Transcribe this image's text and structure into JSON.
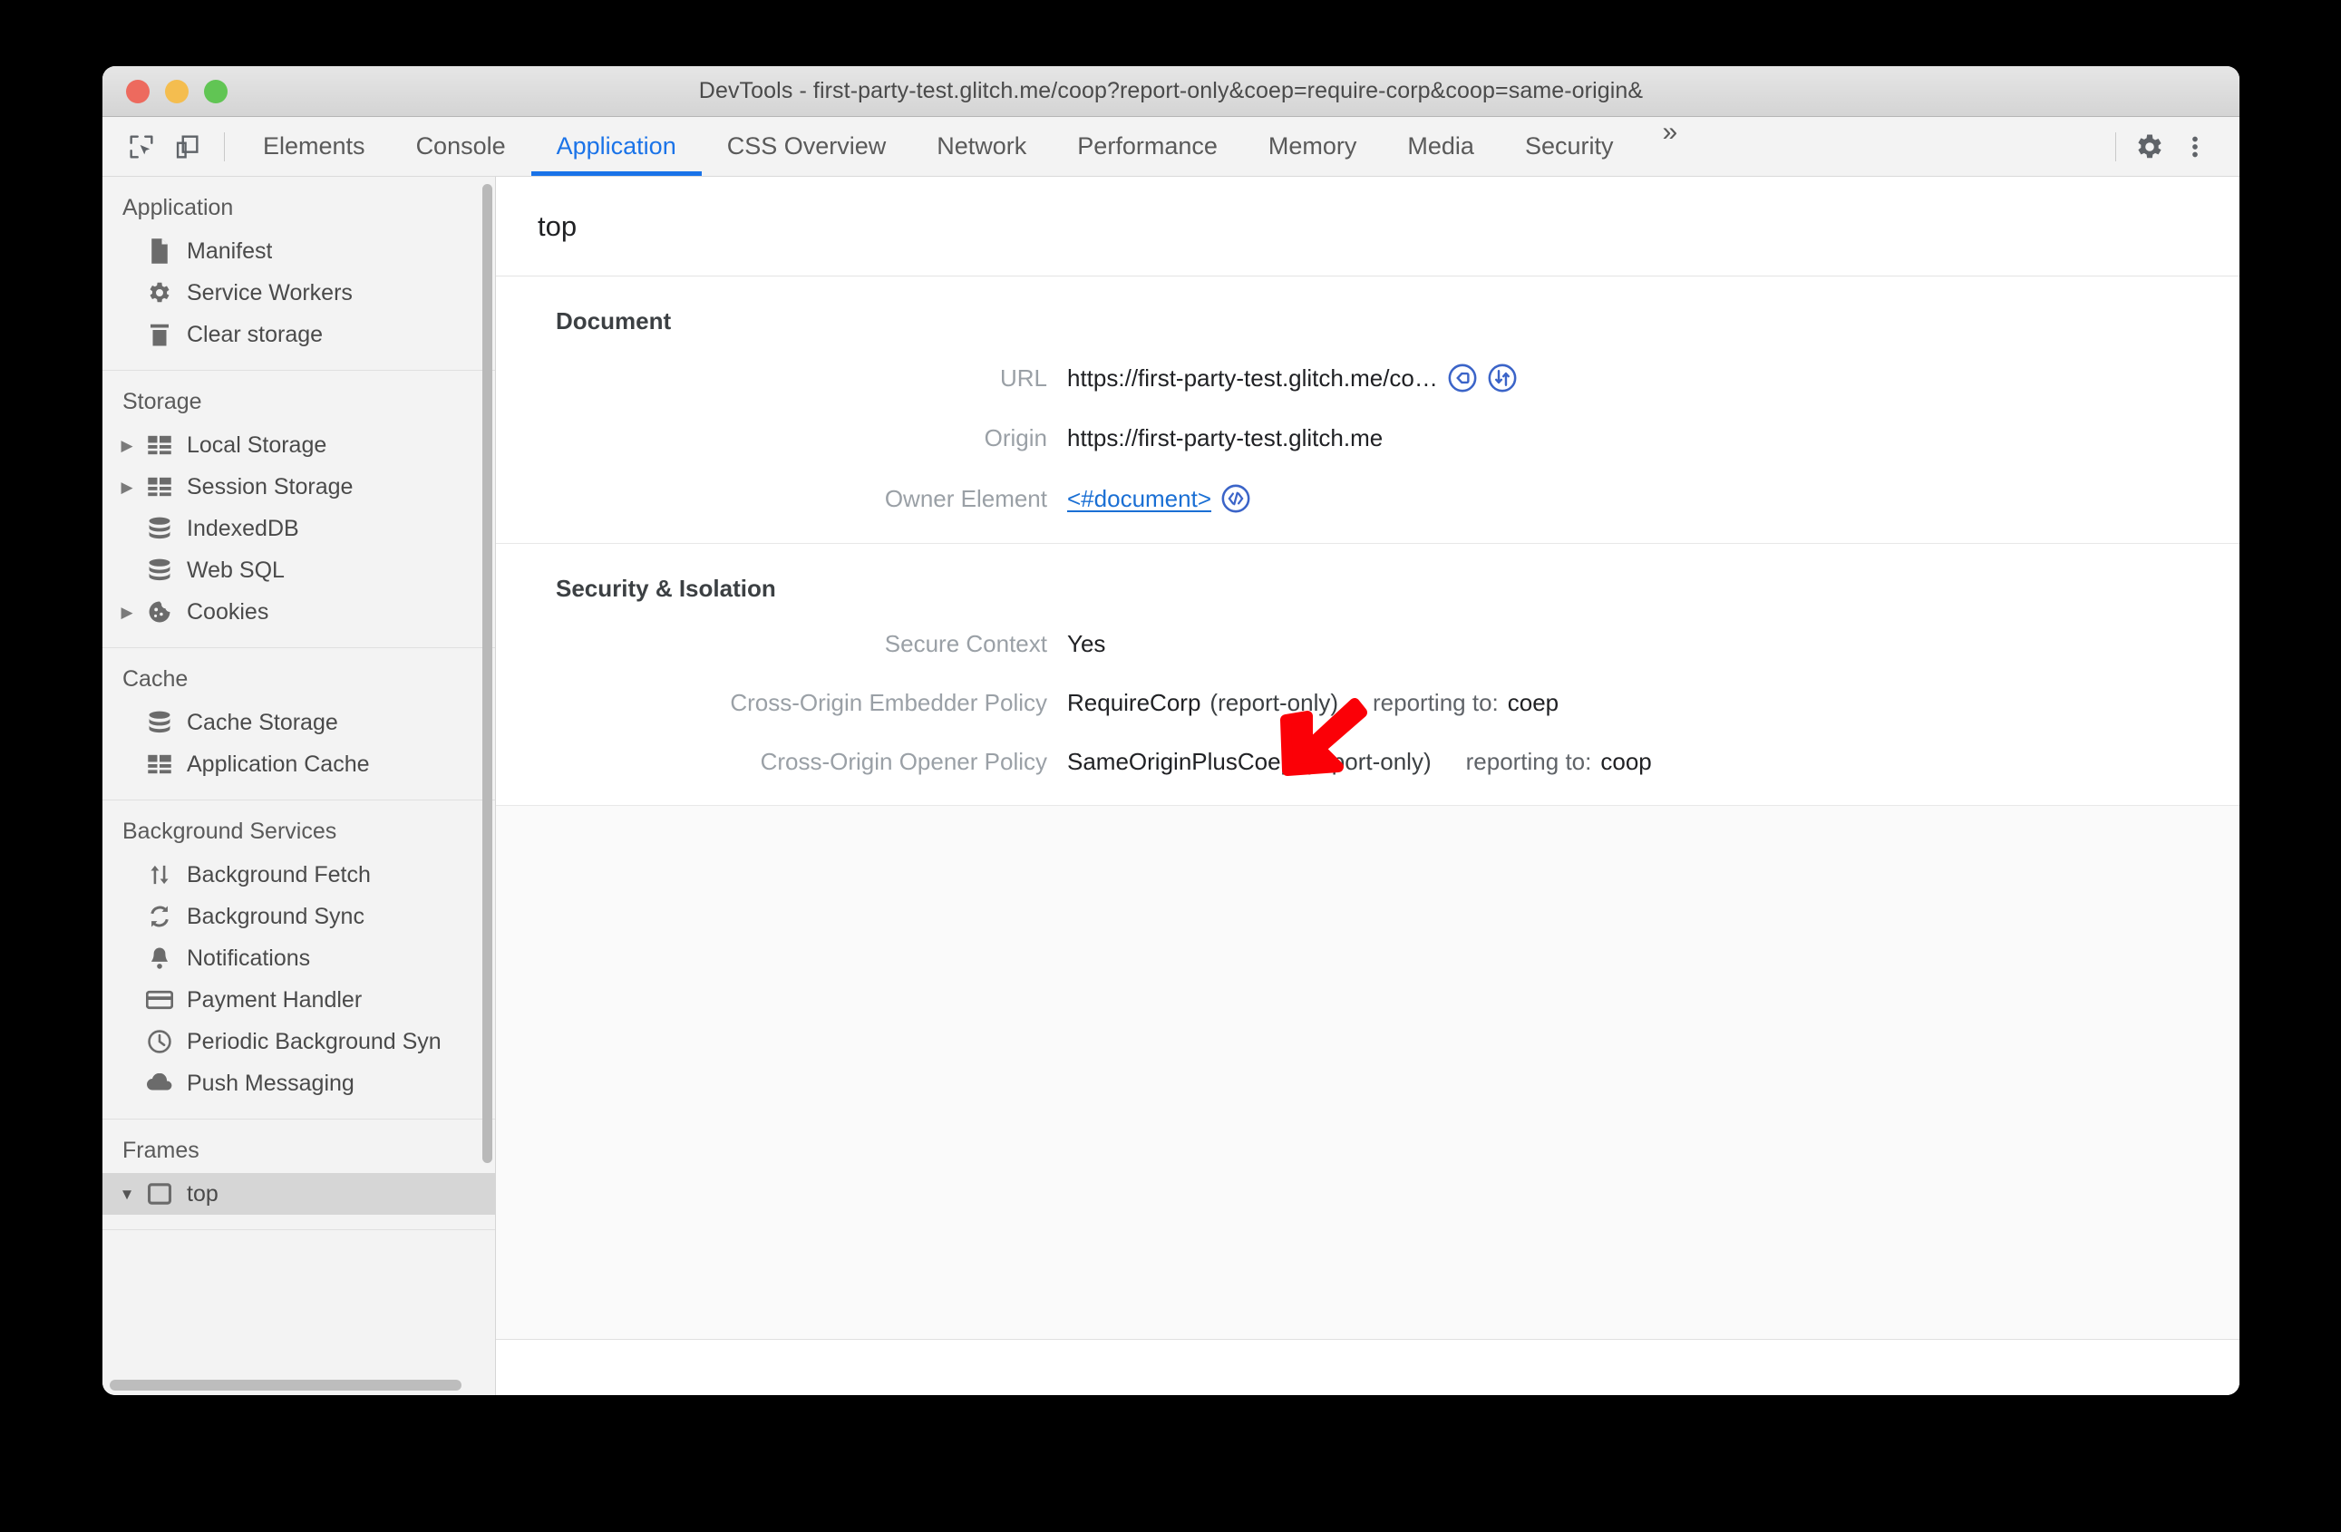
{
  "window": {
    "title": "DevTools - first-party-test.glitch.me/coop?report-only&coep=require-corp&coop=same-origin&"
  },
  "toolbar": {
    "inspect_icon": "inspect-element-icon",
    "device_icon": "device-toolbar-icon",
    "more_tabs_label": "»",
    "settings_icon": "gear-icon",
    "menu_icon": "kebab-menu-icon"
  },
  "tabs": [
    {
      "label": "Elements",
      "active": false
    },
    {
      "label": "Console",
      "active": false
    },
    {
      "label": "Application",
      "active": true
    },
    {
      "label": "CSS Overview",
      "active": false
    },
    {
      "label": "Network",
      "active": false
    },
    {
      "label": "Performance",
      "active": false
    },
    {
      "label": "Memory",
      "active": false
    },
    {
      "label": "Media",
      "active": false
    },
    {
      "label": "Security",
      "active": false
    }
  ],
  "sidebar": {
    "groups": [
      {
        "title": "Application",
        "items": [
          {
            "label": "Manifest",
            "icon": "document-icon",
            "twisty": ""
          },
          {
            "label": "Service Workers",
            "icon": "gear-icon",
            "twisty": ""
          },
          {
            "label": "Clear storage",
            "icon": "trash-icon",
            "twisty": ""
          }
        ]
      },
      {
        "title": "Storage",
        "items": [
          {
            "label": "Local Storage",
            "icon": "table-icon",
            "twisty": "closed"
          },
          {
            "label": "Session Storage",
            "icon": "table-icon",
            "twisty": "closed"
          },
          {
            "label": "IndexedDB",
            "icon": "database-icon",
            "twisty": ""
          },
          {
            "label": "Web SQL",
            "icon": "database-icon",
            "twisty": ""
          },
          {
            "label": "Cookies",
            "icon": "cookie-icon",
            "twisty": "closed"
          }
        ]
      },
      {
        "title": "Cache",
        "items": [
          {
            "label": "Cache Storage",
            "icon": "database-icon",
            "twisty": ""
          },
          {
            "label": "Application Cache",
            "icon": "table-icon",
            "twisty": ""
          }
        ]
      },
      {
        "title": "Background Services",
        "items": [
          {
            "label": "Background Fetch",
            "icon": "transfer-arrows-icon",
            "twisty": ""
          },
          {
            "label": "Background Sync",
            "icon": "sync-icon",
            "twisty": ""
          },
          {
            "label": "Notifications",
            "icon": "bell-icon",
            "twisty": ""
          },
          {
            "label": "Payment Handler",
            "icon": "credit-card-icon",
            "twisty": ""
          },
          {
            "label": "Periodic Background Syn",
            "icon": "clock-icon",
            "twisty": ""
          },
          {
            "label": "Push Messaging",
            "icon": "cloud-icon",
            "twisty": ""
          }
        ]
      },
      {
        "title": "Frames",
        "items": [
          {
            "label": "top",
            "icon": "frame-icon",
            "twisty": "open",
            "selected": true
          }
        ]
      }
    ]
  },
  "main": {
    "frame_name": "top",
    "sections": [
      {
        "title": "Document",
        "rows": [
          {
            "key": "URL",
            "value": "https://first-party-test.glitch.me/co…",
            "icons": [
              "tag-circle-icon",
              "network-transfer-circle-icon"
            ],
            "link": false
          },
          {
            "key": "Origin",
            "value": "https://first-party-test.glitch.me",
            "icons": [],
            "link": false
          },
          {
            "key": "Owner Element",
            "value": "<#document>",
            "icons": [
              "code-circle-icon"
            ],
            "link": true
          }
        ]
      },
      {
        "title": "Security & Isolation",
        "rows": [
          {
            "key": "Secure Context",
            "value": "Yes",
            "icons": [],
            "link": false
          },
          {
            "key": "Cross-Origin Embedder Policy",
            "value": "RequireCorp",
            "note": "(report-only)",
            "reporting_label": "reporting to:",
            "reporting_value": "coep",
            "icons": [],
            "link": false
          },
          {
            "key": "Cross-Origin Opener Policy",
            "value": "SameOriginPlusCoep",
            "note": "(report-only)",
            "reporting_label": "reporting to:",
            "reporting_value": "coop",
            "icons": [],
            "link": false
          }
        ]
      }
    ]
  },
  "annotation": {
    "arrow_color": "#fb0007",
    "arrow_name": "red-pointer-arrow"
  },
  "colors": {
    "accent": "#1a73e8",
    "link": "#1a6fd4",
    "icon_blue": "#3b64c8",
    "sidebar_bg": "#f3f3f3",
    "selected_bg": "#d6d6d6"
  }
}
